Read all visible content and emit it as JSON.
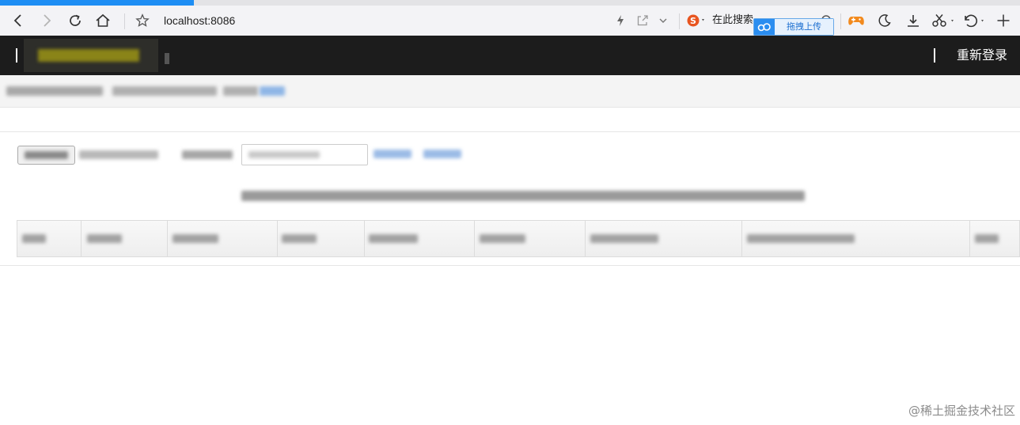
{
  "browser": {
    "address": "localhost:8086",
    "search_label": "在此搜索",
    "cloud_upload_label": "拖拽上传",
    "progress_fraction": 0.19
  },
  "app": {
    "relogin_label": "重新登录"
  },
  "footer": {
    "watermark": "@稀土掘金技术社区"
  },
  "icons": {
    "back": "chevron-left-icon",
    "forward": "chevron-right-icon",
    "reload": "reload-icon",
    "home": "home-icon",
    "bookmark": "star-icon",
    "flash": "lightning-icon",
    "share": "share-icon",
    "dropdown": "chevron-down-icon",
    "search_engine": "sogou-icon",
    "game": "gamepad-icon",
    "night": "moon-icon",
    "download": "download-icon",
    "screenshot": "scissors-icon",
    "undo": "undo-icon",
    "new_tab": "plus-icon",
    "cloud": "cloud-icon"
  },
  "colors": {
    "progress": "#1e8ef4",
    "header_bg": "#1c1c1c",
    "link_blue": "#7aa7e0"
  }
}
